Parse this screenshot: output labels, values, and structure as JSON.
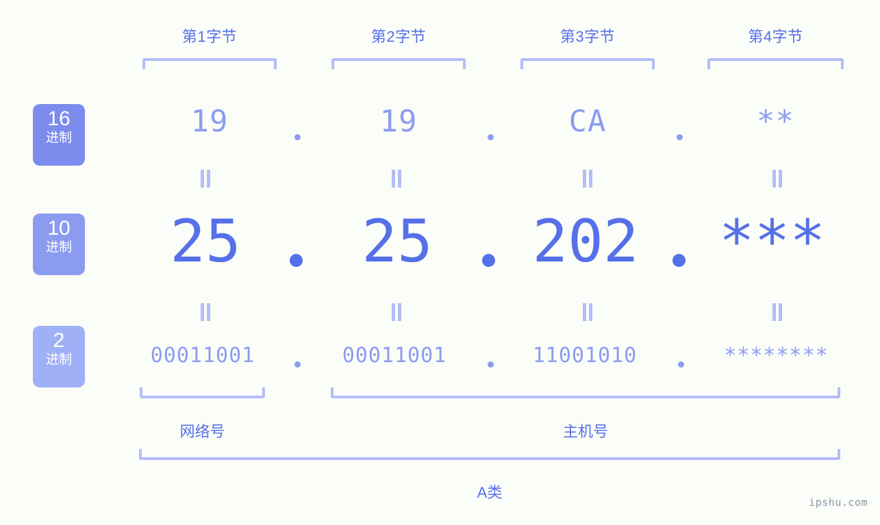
{
  "colors": {
    "background": "#fbfdf8",
    "primary": "#5570e8",
    "secondary": "#8c9cf0",
    "light": "#b3bdf7",
    "badge_hex": "#7b8cec",
    "badge_dec": "#8b9bf0",
    "badge_bin": "#9fb0f6",
    "watermark": "#8b93a8"
  },
  "byte_headers": [
    {
      "label": "第1字节"
    },
    {
      "label": "第2字节"
    },
    {
      "label": "第3字节"
    },
    {
      "label": "第4字节"
    }
  ],
  "bases": [
    {
      "number": "16",
      "suffix": "进制"
    },
    {
      "number": "10",
      "suffix": "进制"
    },
    {
      "number": "2",
      "suffix": "进制"
    }
  ],
  "rows": {
    "hex": {
      "base": "16",
      "values": [
        "19",
        "19",
        "CA",
        "**"
      ]
    },
    "decimal": {
      "base": "10",
      "values": [
        "25",
        "25",
        "202",
        "***"
      ]
    },
    "binary": {
      "base": "2",
      "values": [
        "00011001",
        "00011001",
        "11001010",
        "********"
      ]
    }
  },
  "separator": ".",
  "equals_mark": "=",
  "sections": [
    {
      "label": "网络号"
    },
    {
      "label": "主机号"
    }
  ],
  "ip_class": {
    "label": "A类"
  },
  "watermark": {
    "text": "ipshu.com"
  }
}
